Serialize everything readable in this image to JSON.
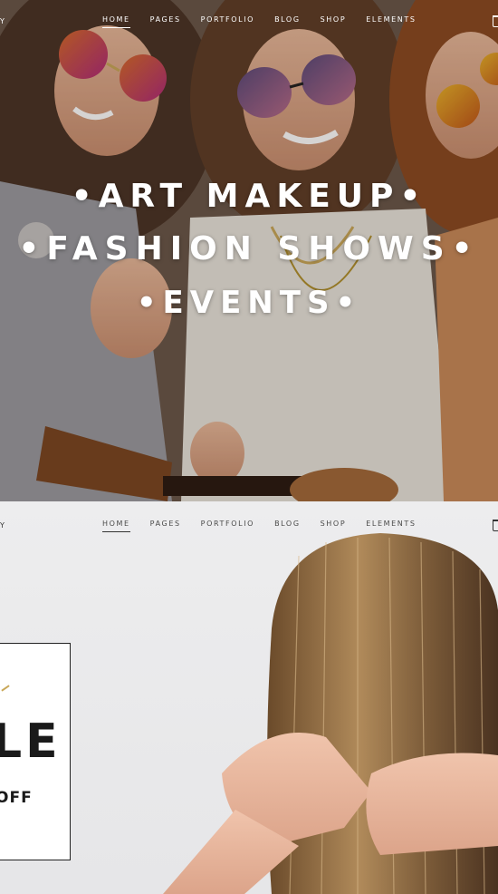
{
  "hero": {
    "brand_fragment": "Y",
    "nav": [
      "HOME",
      "PAGES",
      "PORTFOLIO",
      "BLOG",
      "SHOP",
      "ELEMENTS"
    ],
    "active_nav": "HOME",
    "headline_lines": [
      "•ART MAKEUP•",
      "•FASHION SHOWS•",
      "•EVENTS•"
    ]
  },
  "section2": {
    "brand_fragment": "Y",
    "nav": [
      "HOME",
      "PAGES",
      "PORTFOLIO",
      "BLOG",
      "SHOP",
      "ELEMENTS"
    ],
    "active_nav": "HOME",
    "sale_big": "LE",
    "sale_off": "OFF"
  },
  "colors": {
    "accent_gold": "#c9a85a",
    "text_dark": "#1a1a1a"
  },
  "icons": [
    "cart-icon"
  ]
}
